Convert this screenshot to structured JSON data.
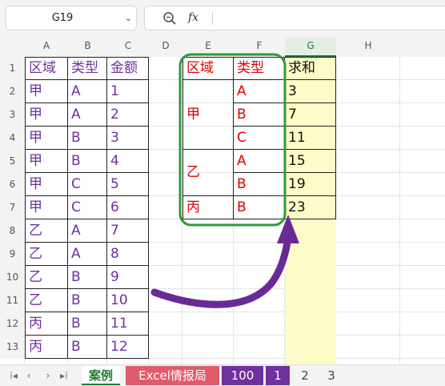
{
  "name_box": {
    "value": "G19",
    "caret": "⌄"
  },
  "formula_bar": {
    "fx_label": "fx",
    "value": ""
  },
  "column_headers": [
    "A",
    "B",
    "C",
    "D",
    "E",
    "F",
    "G",
    "H"
  ],
  "selected_column": "G",
  "row_headers": [
    "1",
    "2",
    "3",
    "4",
    "5",
    "6",
    "7",
    "8",
    "9",
    "10",
    "11",
    "12",
    "13"
  ],
  "source_table": {
    "headers": [
      "区域",
      "类型",
      "金额"
    ],
    "rows": [
      [
        "甲",
        "A",
        "1"
      ],
      [
        "甲",
        "A",
        "2"
      ],
      [
        "甲",
        "B",
        "3"
      ],
      [
        "甲",
        "B",
        "4"
      ],
      [
        "甲",
        "C",
        "5"
      ],
      [
        "甲",
        "C",
        "6"
      ],
      [
        "乙",
        "A",
        "7"
      ],
      [
        "乙",
        "A",
        "8"
      ],
      [
        "乙",
        "B",
        "9"
      ],
      [
        "乙",
        "B",
        "10"
      ],
      [
        "丙",
        "B",
        "11"
      ],
      [
        "丙",
        "B",
        "12"
      ]
    ]
  },
  "summary_table": {
    "headers": [
      "区域",
      "类型",
      "求和"
    ],
    "regions": [
      "甲",
      "乙",
      "丙"
    ],
    "types": [
      "A",
      "B",
      "C",
      "A",
      "B",
      "B"
    ],
    "sums": [
      "3",
      "7",
      "11",
      "15",
      "19",
      "23"
    ]
  },
  "colors": {
    "purple": "#7030a0",
    "red": "#e00000",
    "green_outline": "#2e9a3c",
    "highlight": "#fdfcc9",
    "arrow": "#6a2a95"
  },
  "sheet_tabs": {
    "nav": [
      "⁞◂",
      "‹",
      "›",
      "▸⁞"
    ],
    "tabs": [
      "案例",
      "Excel情报局",
      "100",
      "1",
      "2",
      "3"
    ],
    "active": "案例"
  }
}
